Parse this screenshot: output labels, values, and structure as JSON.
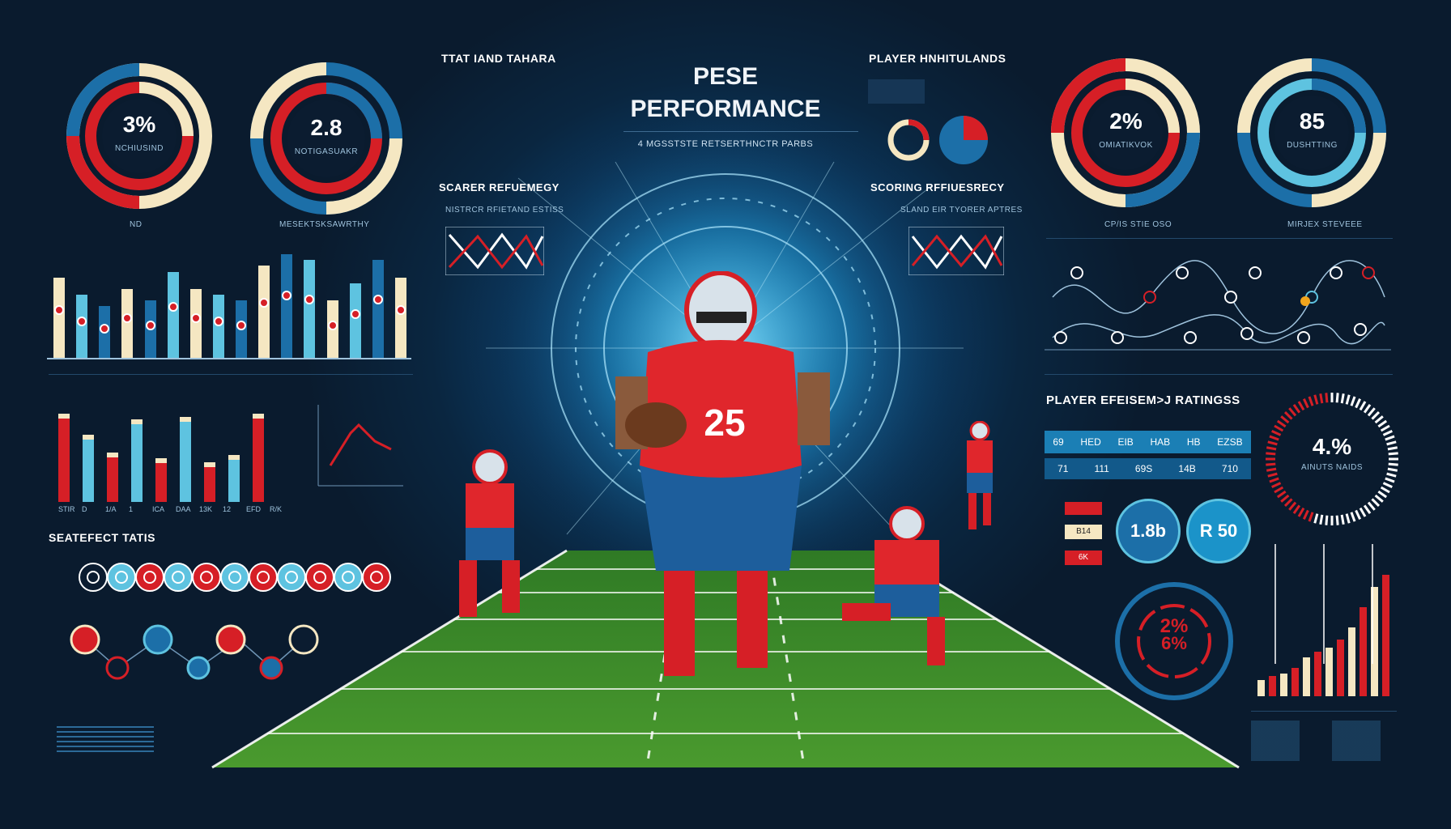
{
  "colors": {
    "red": "#d61f26",
    "blue": "#1c6fa8",
    "lightblue": "#5ec3e0",
    "cream": "#f5e7c2",
    "bg": "#0b1c30",
    "field": "#3f8f2a"
  },
  "title": {
    "line1": "PESE",
    "line2": "PERFORMANCE",
    "subtitle": "4 MGSSTSTE RETSERTHNCTR PARBS"
  },
  "headers": {
    "top_center_left": "TTAT IAND TAHARA",
    "top_center_right": "PLAYER HNHITULANDS",
    "mid_left": "SCARER REFUEMEGY",
    "mid_left_sub": "NISTRCR RFIETAND ESTISS",
    "mid_right": "SCORING RFFIUESRECY",
    "mid_right_sub": "SLAND EIR TYORER APTRES",
    "left_stats": "SEATEFECT TATIS",
    "right_ratings": "PLAYER EFEISEM>J RATINGSS"
  },
  "donuts_left": [
    {
      "value": "3%",
      "caption": "NCHIUSIND",
      "below": "ND"
    },
    {
      "value": "2.8",
      "caption": "NOTIGASUAKR",
      "below": "MESEKTSKSAWRTHY"
    }
  ],
  "donuts_right": [
    {
      "value": "2%",
      "caption": "OMIATIKVOK",
      "below": "CP/IS STIE OSO"
    },
    {
      "value": "85",
      "caption": "DUSHTTING",
      "below": "MIRJEX STEVEEE"
    }
  ],
  "bar_labels": [
    "STIR",
    "D",
    "1/A",
    "1",
    "ICA",
    "DAA",
    "13K",
    "12",
    "EFD",
    "R/K"
  ],
  "bar_chart_1": {
    "values": [
      0.7,
      0.55,
      0.45,
      0.6,
      0.5,
      0.75,
      0.6,
      0.55,
      0.5,
      0.8,
      0.9,
      0.85,
      0.5,
      0.65,
      0.85,
      0.7
    ]
  },
  "bar_chart_2": {
    "values": [
      0.85,
      0.65,
      0.48,
      0.8,
      0.42,
      0.82,
      0.38,
      0.45,
      0.85
    ]
  },
  "ratings_table": {
    "row1": [
      "69",
      "HED",
      "EIB",
      "HAB",
      "HB",
      "EZSB"
    ],
    "row2": [
      "71",
      "111",
      "69S",
      "14B",
      "710"
    ]
  },
  "tags": [
    "B14",
    "6K"
  ],
  "stat_circles": [
    {
      "value": "1.8b"
    },
    {
      "value": "R 50"
    }
  ],
  "ring_gauge": {
    "value": "2%",
    "value2": "6%"
  },
  "gauge": {
    "value": "4.%",
    "caption": "AINUTS NAIDS"
  },
  "player_jersey": "25"
}
